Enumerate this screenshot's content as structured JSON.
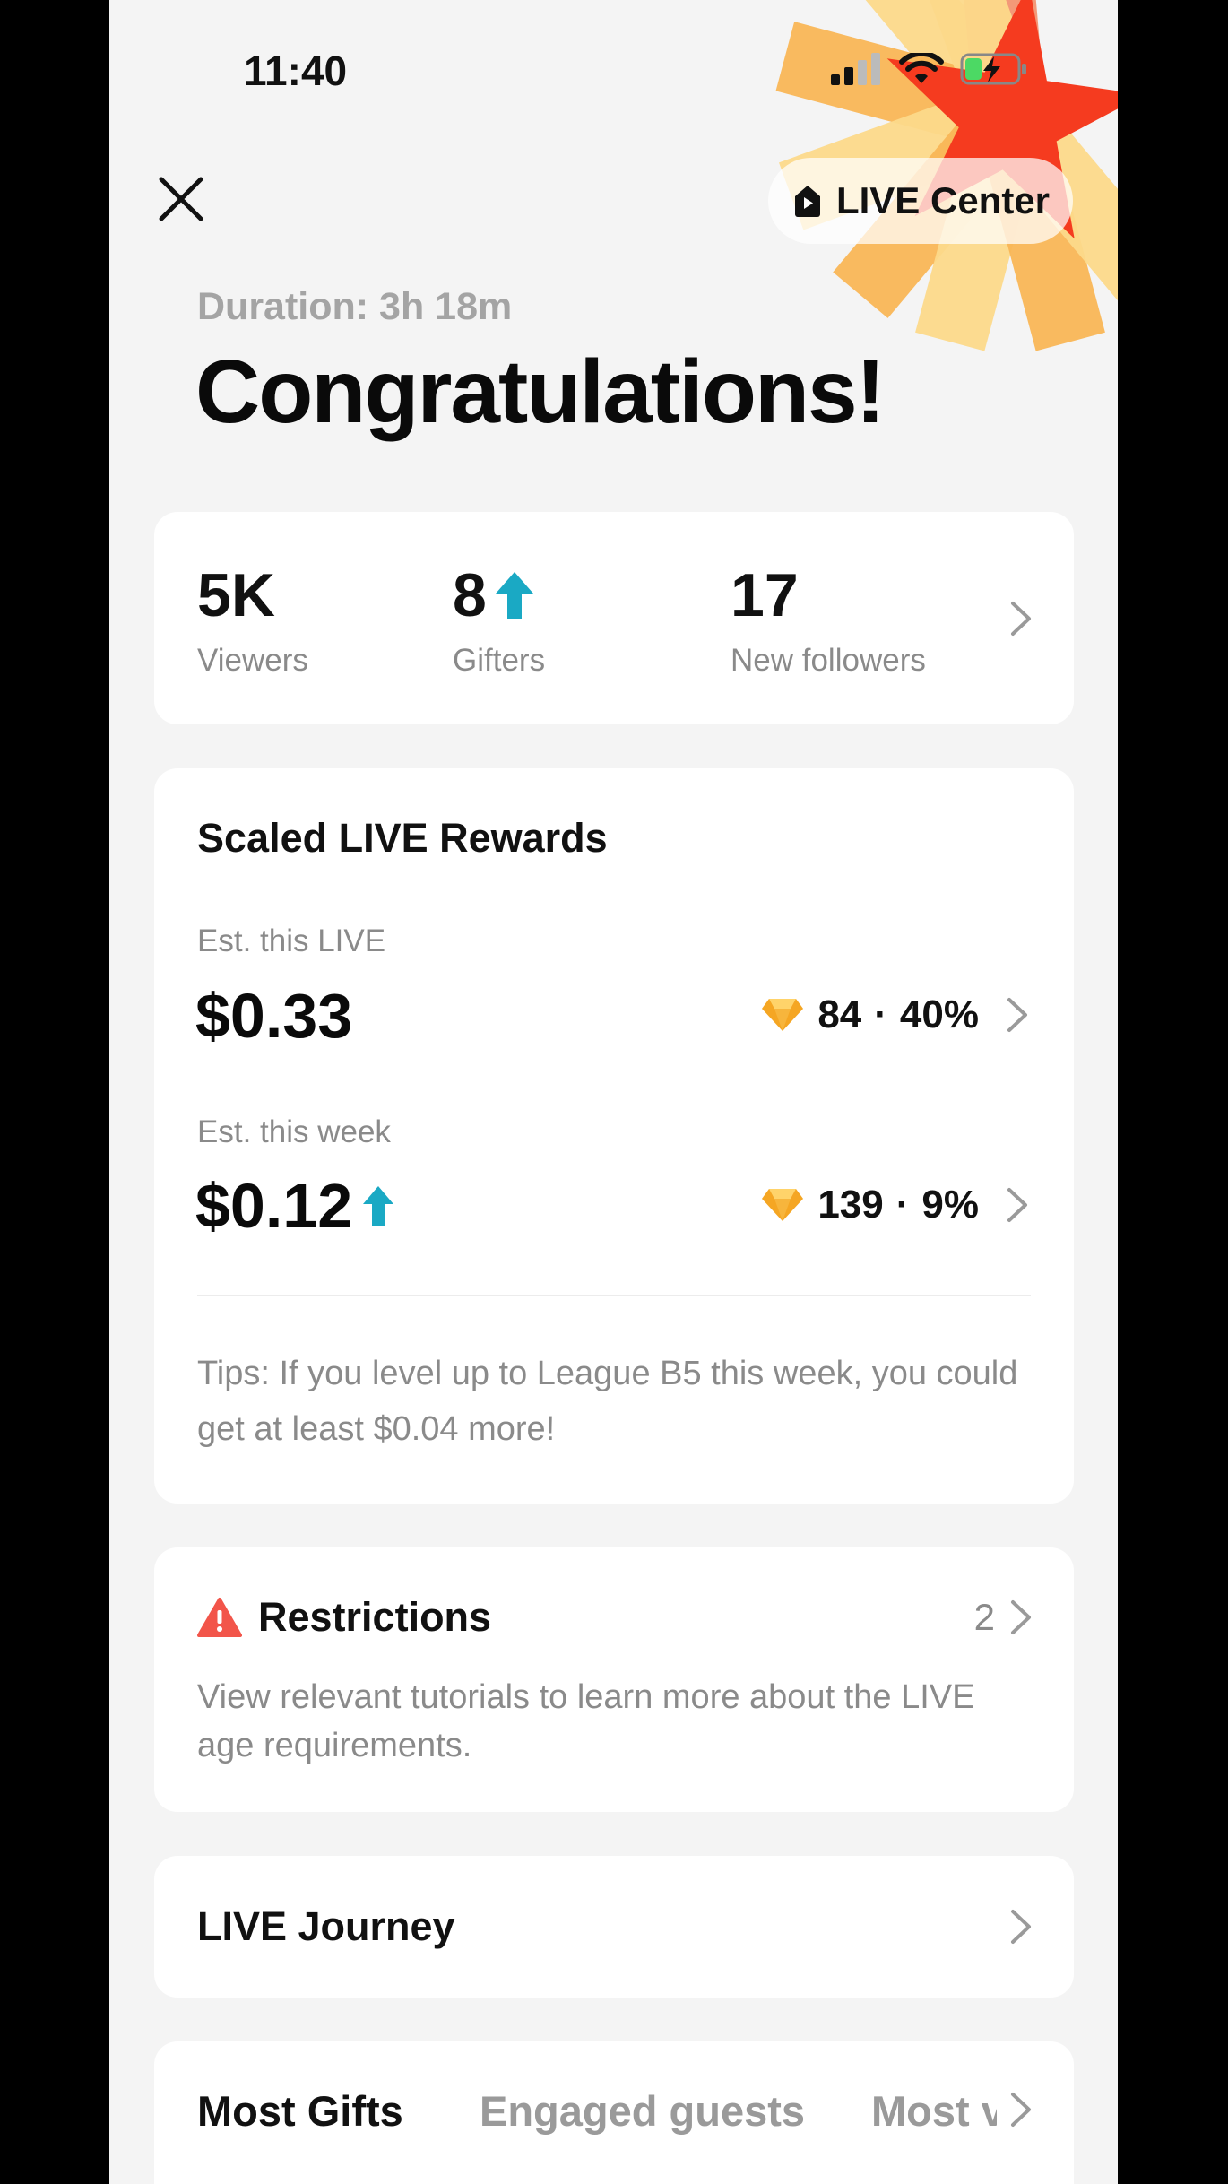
{
  "status_bar": {
    "time": "11:40"
  },
  "header": {
    "live_center_label": "LIVE Center"
  },
  "summary": {
    "duration": "Duration: 3h 18m",
    "title": "Congratulations!"
  },
  "stats": {
    "viewers": {
      "value": "5K",
      "label": "Viewers"
    },
    "gifters": {
      "value": "8",
      "label": "Gifters"
    },
    "followers": {
      "value": "17",
      "label": "New followers"
    }
  },
  "rewards": {
    "title": "Scaled LIVE Rewards",
    "live": {
      "label": "Est. this LIVE",
      "amount": "$0.33",
      "diamonds": "84",
      "sep": "·",
      "percent": "40%"
    },
    "week": {
      "label": "Est. this week",
      "amount": "$0.12",
      "diamonds": "139",
      "sep": "·",
      "percent": "9%"
    },
    "tips": "Tips: If you level up to League B5 this week, you could get at least $0.04 more!"
  },
  "restrictions": {
    "title": "Restrictions",
    "count": "2",
    "description": "View relevant tutorials to learn more about the LIVE age requirements."
  },
  "journey": {
    "title": "LIVE Journey"
  },
  "tabs": {
    "items": [
      "Most Gifts",
      "Engaged guests",
      "Most v"
    ]
  },
  "colors": {
    "accent_teal": "#1aa9c4",
    "warning_red": "#f2554a",
    "diamond_gold": "#f5a623"
  }
}
